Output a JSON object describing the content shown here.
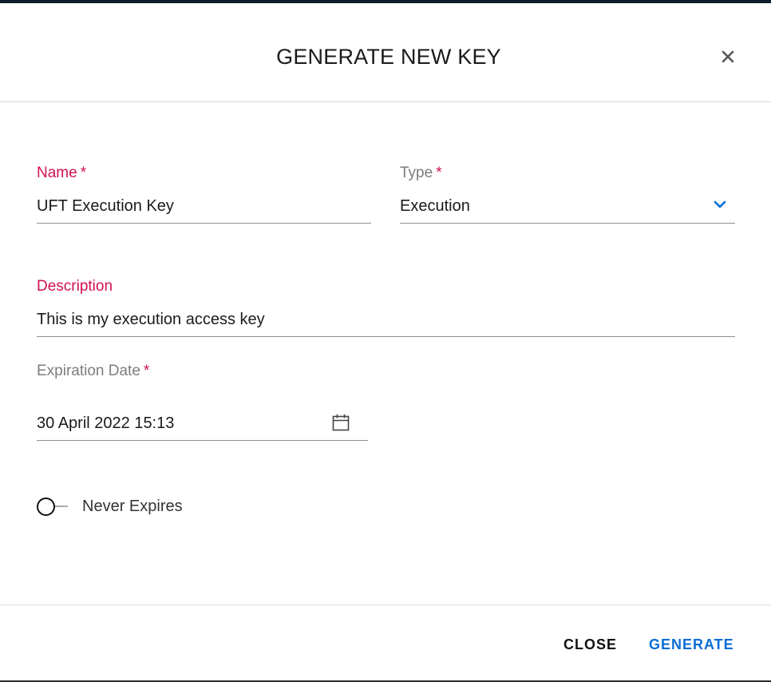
{
  "dialog": {
    "title": "GENERATE NEW KEY"
  },
  "form": {
    "name": {
      "label": "Name",
      "required": "*",
      "value": "UFT Execution Key"
    },
    "type": {
      "label": "Type",
      "required": "*",
      "value": "Execution"
    },
    "description": {
      "label": "Description",
      "value": "This is my execution access key"
    },
    "expiration": {
      "label": "Expiration Date",
      "required": "*",
      "value": "30 April 2022 15:13"
    },
    "never_expires": {
      "label": "Never Expires",
      "checked": false
    }
  },
  "footer": {
    "close_label": "CLOSE",
    "generate_label": "GENERATE"
  },
  "colors": {
    "accent": "#0a6ed6",
    "required_label": "#d0114e",
    "top_bar": "#0f1b2d"
  },
  "icons": {
    "close": "close-icon",
    "dropdown": "chevron-down-icon",
    "calendar": "calendar-icon"
  }
}
